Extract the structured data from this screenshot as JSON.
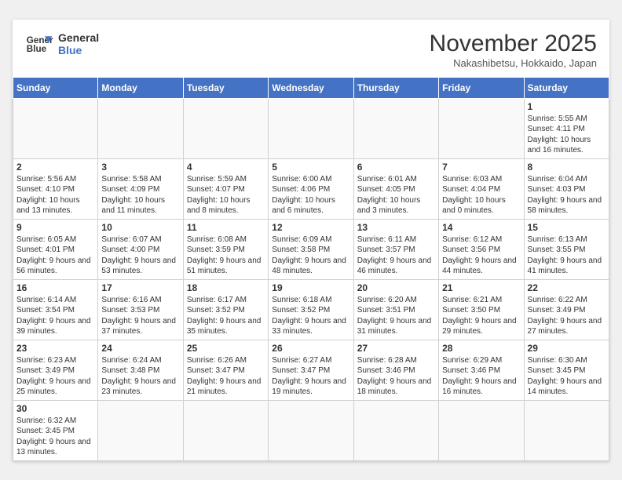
{
  "header": {
    "logo_line1": "General",
    "logo_line2": "Blue",
    "month_year": "November 2025",
    "location": "Nakashibetsu, Hokkaido, Japan"
  },
  "weekdays": [
    "Sunday",
    "Monday",
    "Tuesday",
    "Wednesday",
    "Thursday",
    "Friday",
    "Saturday"
  ],
  "weeks": [
    [
      {
        "day": "",
        "info": ""
      },
      {
        "day": "",
        "info": ""
      },
      {
        "day": "",
        "info": ""
      },
      {
        "day": "",
        "info": ""
      },
      {
        "day": "",
        "info": ""
      },
      {
        "day": "",
        "info": ""
      },
      {
        "day": "1",
        "info": "Sunrise: 5:55 AM\nSunset: 4:11 PM\nDaylight: 10 hours and 16 minutes."
      }
    ],
    [
      {
        "day": "2",
        "info": "Sunrise: 5:56 AM\nSunset: 4:10 PM\nDaylight: 10 hours and 13 minutes."
      },
      {
        "day": "3",
        "info": "Sunrise: 5:58 AM\nSunset: 4:09 PM\nDaylight: 10 hours and 11 minutes."
      },
      {
        "day": "4",
        "info": "Sunrise: 5:59 AM\nSunset: 4:07 PM\nDaylight: 10 hours and 8 minutes."
      },
      {
        "day": "5",
        "info": "Sunrise: 6:00 AM\nSunset: 4:06 PM\nDaylight: 10 hours and 6 minutes."
      },
      {
        "day": "6",
        "info": "Sunrise: 6:01 AM\nSunset: 4:05 PM\nDaylight: 10 hours and 3 minutes."
      },
      {
        "day": "7",
        "info": "Sunrise: 6:03 AM\nSunset: 4:04 PM\nDaylight: 10 hours and 0 minutes."
      },
      {
        "day": "8",
        "info": "Sunrise: 6:04 AM\nSunset: 4:03 PM\nDaylight: 9 hours and 58 minutes."
      }
    ],
    [
      {
        "day": "9",
        "info": "Sunrise: 6:05 AM\nSunset: 4:01 PM\nDaylight: 9 hours and 56 minutes."
      },
      {
        "day": "10",
        "info": "Sunrise: 6:07 AM\nSunset: 4:00 PM\nDaylight: 9 hours and 53 minutes."
      },
      {
        "day": "11",
        "info": "Sunrise: 6:08 AM\nSunset: 3:59 PM\nDaylight: 9 hours and 51 minutes."
      },
      {
        "day": "12",
        "info": "Sunrise: 6:09 AM\nSunset: 3:58 PM\nDaylight: 9 hours and 48 minutes."
      },
      {
        "day": "13",
        "info": "Sunrise: 6:11 AM\nSunset: 3:57 PM\nDaylight: 9 hours and 46 minutes."
      },
      {
        "day": "14",
        "info": "Sunrise: 6:12 AM\nSunset: 3:56 PM\nDaylight: 9 hours and 44 minutes."
      },
      {
        "day": "15",
        "info": "Sunrise: 6:13 AM\nSunset: 3:55 PM\nDaylight: 9 hours and 41 minutes."
      }
    ],
    [
      {
        "day": "16",
        "info": "Sunrise: 6:14 AM\nSunset: 3:54 PM\nDaylight: 9 hours and 39 minutes."
      },
      {
        "day": "17",
        "info": "Sunrise: 6:16 AM\nSunset: 3:53 PM\nDaylight: 9 hours and 37 minutes."
      },
      {
        "day": "18",
        "info": "Sunrise: 6:17 AM\nSunset: 3:52 PM\nDaylight: 9 hours and 35 minutes."
      },
      {
        "day": "19",
        "info": "Sunrise: 6:18 AM\nSunset: 3:52 PM\nDaylight: 9 hours and 33 minutes."
      },
      {
        "day": "20",
        "info": "Sunrise: 6:20 AM\nSunset: 3:51 PM\nDaylight: 9 hours and 31 minutes."
      },
      {
        "day": "21",
        "info": "Sunrise: 6:21 AM\nSunset: 3:50 PM\nDaylight: 9 hours and 29 minutes."
      },
      {
        "day": "22",
        "info": "Sunrise: 6:22 AM\nSunset: 3:49 PM\nDaylight: 9 hours and 27 minutes."
      }
    ],
    [
      {
        "day": "23",
        "info": "Sunrise: 6:23 AM\nSunset: 3:49 PM\nDaylight: 9 hours and 25 minutes."
      },
      {
        "day": "24",
        "info": "Sunrise: 6:24 AM\nSunset: 3:48 PM\nDaylight: 9 hours and 23 minutes."
      },
      {
        "day": "25",
        "info": "Sunrise: 6:26 AM\nSunset: 3:47 PM\nDaylight: 9 hours and 21 minutes."
      },
      {
        "day": "26",
        "info": "Sunrise: 6:27 AM\nSunset: 3:47 PM\nDaylight: 9 hours and 19 minutes."
      },
      {
        "day": "27",
        "info": "Sunrise: 6:28 AM\nSunset: 3:46 PM\nDaylight: 9 hours and 18 minutes."
      },
      {
        "day": "28",
        "info": "Sunrise: 6:29 AM\nSunset: 3:46 PM\nDaylight: 9 hours and 16 minutes."
      },
      {
        "day": "29",
        "info": "Sunrise: 6:30 AM\nSunset: 3:45 PM\nDaylight: 9 hours and 14 minutes."
      }
    ],
    [
      {
        "day": "30",
        "info": "Sunrise: 6:32 AM\nSunset: 3:45 PM\nDaylight: 9 hours and 13 minutes."
      },
      {
        "day": "",
        "info": ""
      },
      {
        "day": "",
        "info": ""
      },
      {
        "day": "",
        "info": ""
      },
      {
        "day": "",
        "info": ""
      },
      {
        "day": "",
        "info": ""
      },
      {
        "day": "",
        "info": ""
      }
    ]
  ]
}
